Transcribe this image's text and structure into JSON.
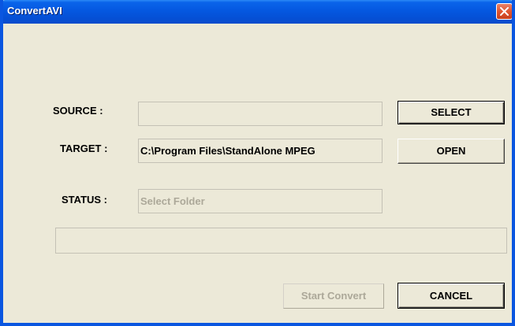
{
  "window": {
    "title": "ConvertAVI"
  },
  "form": {
    "source_label": "SOURCE :",
    "source_value": "",
    "target_label": "TARGET :",
    "target_value": "C:\\Program Files\\StandAlone MPEG",
    "status_label": "STATUS :",
    "status_value": "Select Folder",
    "progress": 0
  },
  "buttons": {
    "select": "SELECT",
    "open": "OPEN",
    "start_convert": "Start Convert",
    "cancel": "CANCEL"
  },
  "icons": {
    "close": "close-icon"
  },
  "colors": {
    "titlebar": "#0558e0",
    "close_button": "#e0542f",
    "window_bg": "#ece9d8",
    "disabled_text": "#aca899"
  }
}
